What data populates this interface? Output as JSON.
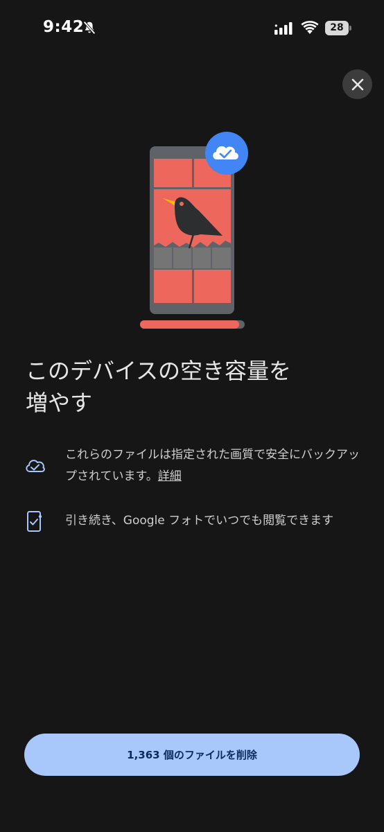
{
  "status_bar": {
    "time": "9:42",
    "battery_level": "28",
    "icons": [
      "bell-slash-icon",
      "cellular-signal-icon",
      "wifi-icon",
      "battery-icon"
    ]
  },
  "close": {
    "icon": "close-icon"
  },
  "illustration": {
    "badge_icon": "cloud-check-icon",
    "progress": 0.95,
    "colors": {
      "tile": "#ee675c",
      "phone_frame": "#5f6368",
      "badge": "#4285f4",
      "progress_fill": "#ee675c",
      "progress_track": "#5f6368"
    }
  },
  "title": "このデバイスの空き容量を増やす",
  "features": [
    {
      "icon": "cloud-check-icon",
      "text": "これらのファイルは指定された画質で安全にバックアップされています。",
      "link": "詳細"
    },
    {
      "icon": "phone-check-icon",
      "text": "引き続き、Google フォトでいつでも閲覧できます"
    }
  ],
  "primary_action": {
    "label": "1,363 個のファイルを削除",
    "color": "#a8c7fa"
  }
}
